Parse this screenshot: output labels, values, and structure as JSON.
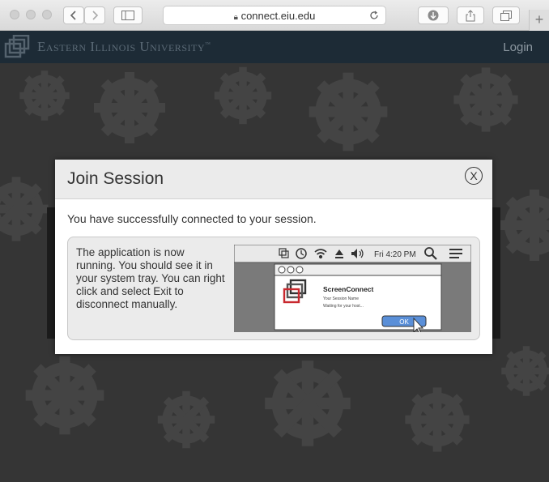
{
  "browser": {
    "url": "connect.eiu.edu",
    "new_tab_label": "+"
  },
  "site": {
    "brand": "Eastern Illinois University",
    "trademark": "™",
    "login_label": "Login"
  },
  "modal": {
    "title": "Join Session",
    "close_glyph": "X",
    "message": "You have successfully connected to your session.",
    "instructions": "The application is now running. You should see it in your system tray. You can right click and select Exit to disconnect manually.",
    "illustration": {
      "clock": "Fri 4:20 PM",
      "app_name": "ScreenConnect",
      "session_name": "Your Session Name",
      "status": "Waiting for your host...",
      "ok_label": "OK"
    }
  },
  "colors": {
    "header_bg": "#1d2b36",
    "page_bg": "#353535",
    "modal_head_bg": "#ebebeb",
    "ok_button": "#5a8fd8",
    "logo_red": "#c8282e"
  }
}
